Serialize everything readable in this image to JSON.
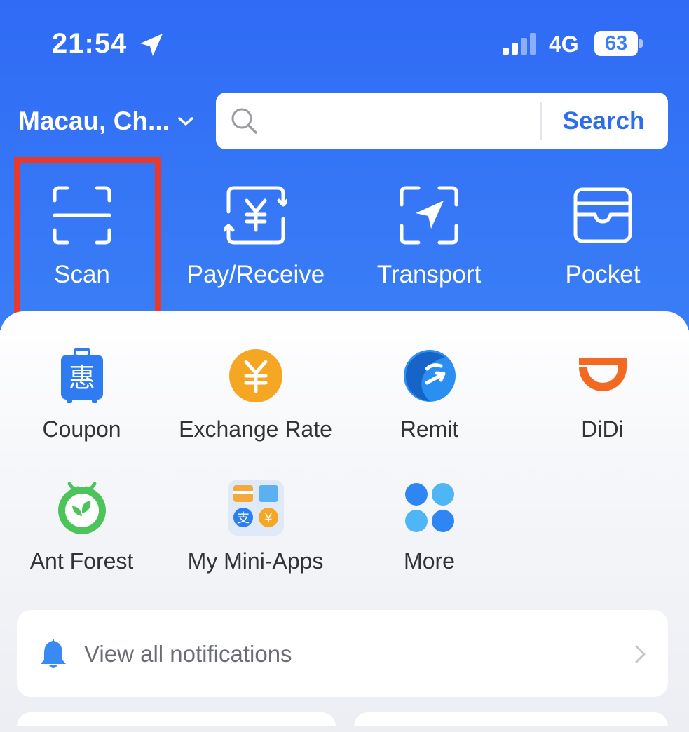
{
  "status_bar": {
    "time": "21:54",
    "network": "4G",
    "battery": "63"
  },
  "header": {
    "location": "Macau, Ch...",
    "search": {
      "placeholder": "",
      "button_label": "Search"
    },
    "primary_actions": [
      {
        "label": "Scan",
        "icon": "scan-icon"
      },
      {
        "label": "Pay/Receive",
        "icon": "pay-receive-icon"
      },
      {
        "label": "Transport",
        "icon": "transport-icon"
      },
      {
        "label": "Pocket",
        "icon": "pocket-icon"
      }
    ]
  },
  "apps": [
    {
      "label": "Coupon",
      "icon": "coupon-icon",
      "color": "#2f7bf2"
    },
    {
      "label": "Exchange Rate",
      "icon": "exchange-rate-icon",
      "color": "#f5a623"
    },
    {
      "label": "Remit",
      "icon": "remit-icon",
      "color": "#2a8ff0"
    },
    {
      "label": "DiDi",
      "icon": "didi-icon",
      "color": "#f26a21"
    },
    {
      "label": "Ant Forest",
      "icon": "ant-forest-icon",
      "color": "#4cc45a"
    },
    {
      "label": "My Mini-Apps",
      "icon": "mini-apps-icon",
      "color": "#4a8ff0"
    },
    {
      "label": "More",
      "icon": "more-icon",
      "color": "#2e86f5"
    }
  ],
  "notifications": {
    "label": "View all notifications"
  },
  "colors": {
    "header_blue": "#3a7ef6",
    "highlight_red": "#e8392a",
    "link_blue": "#2b6cf0"
  }
}
